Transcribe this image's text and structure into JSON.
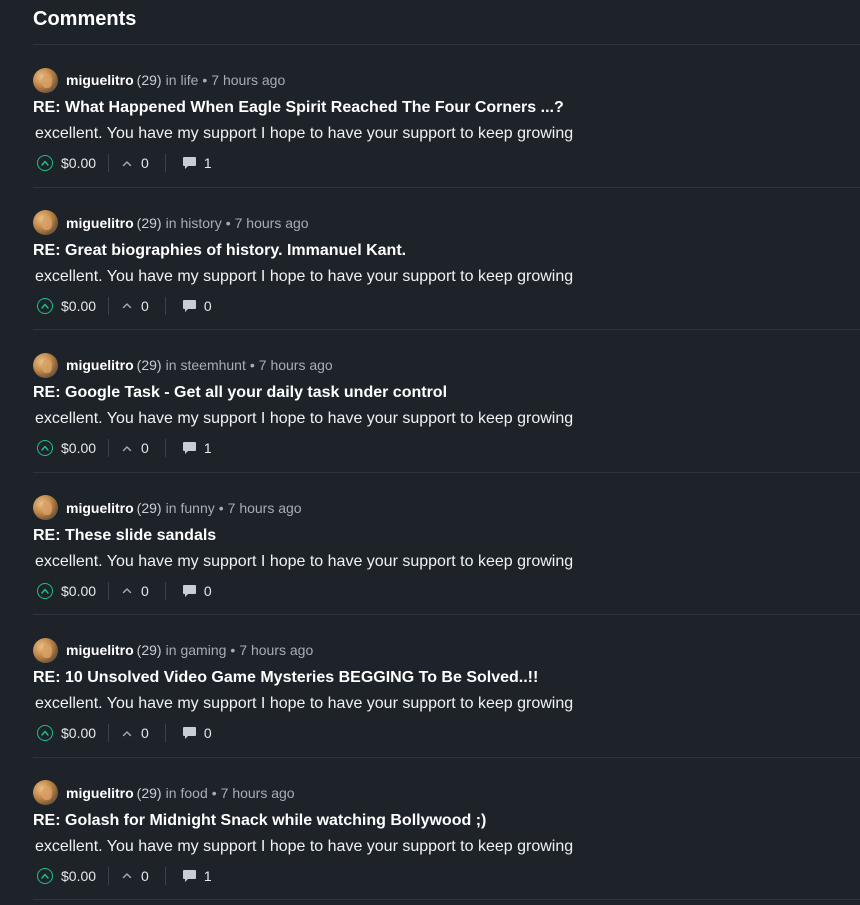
{
  "heading": "Comments",
  "comments": [
    {
      "author": "miguelitro",
      "reputation": "(29)",
      "in_label": "in",
      "category": "life",
      "dot": "•",
      "time": "7 hours ago",
      "title": "RE: What Happened When Eagle Spirit Reached The Four Corners ...?",
      "body": "excellent. You have my support I hope to have your support to keep growing",
      "payout": "$0.00",
      "votes": "0",
      "replies": "1"
    },
    {
      "author": "miguelitro",
      "reputation": "(29)",
      "in_label": "in",
      "category": "history",
      "dot": "•",
      "time": "7 hours ago",
      "title": "RE: Great biographies of history. Immanuel Kant.",
      "body": "excellent. You have my support I hope to have your support to keep growing",
      "payout": "$0.00",
      "votes": "0",
      "replies": "0"
    },
    {
      "author": "miguelitro",
      "reputation": "(29)",
      "in_label": "in",
      "category": "steemhunt",
      "dot": "•",
      "time": "7 hours ago",
      "title": "RE: Google Task - Get all your daily task under control",
      "body": "excellent. You have my support I hope to have your support to keep growing",
      "payout": "$0.00",
      "votes": "0",
      "replies": "1"
    },
    {
      "author": "miguelitro",
      "reputation": "(29)",
      "in_label": "in",
      "category": "funny",
      "dot": "•",
      "time": "7 hours ago",
      "title": "RE: These slide sandals",
      "body": "excellent. You have my support I hope to have your support to keep growing",
      "payout": "$0.00",
      "votes": "0",
      "replies": "0"
    },
    {
      "author": "miguelitro",
      "reputation": "(29)",
      "in_label": "in",
      "category": "gaming",
      "dot": "•",
      "time": "7 hours ago",
      "title": "RE: 10 Unsolved Video Game Mysteries BEGGING To Be Solved..!!",
      "body": "excellent. You have my support I hope to have your support to keep growing",
      "payout": "$0.00",
      "votes": "0",
      "replies": "0"
    },
    {
      "author": "miguelitro",
      "reputation": "(29)",
      "in_label": "in",
      "category": "food",
      "dot": "•",
      "time": "7 hours ago",
      "title": "RE: Golash for Midnight Snack while watching Bollywood ;)",
      "body": "excellent. You have my support I hope to have your support to keep growing",
      "payout": "$0.00",
      "votes": "0",
      "replies": "1"
    }
  ],
  "colors": {
    "background": "#1e2329",
    "accent": "#1fbf8f",
    "divider": "#2c333b",
    "muted_text": "#a5adb6"
  }
}
